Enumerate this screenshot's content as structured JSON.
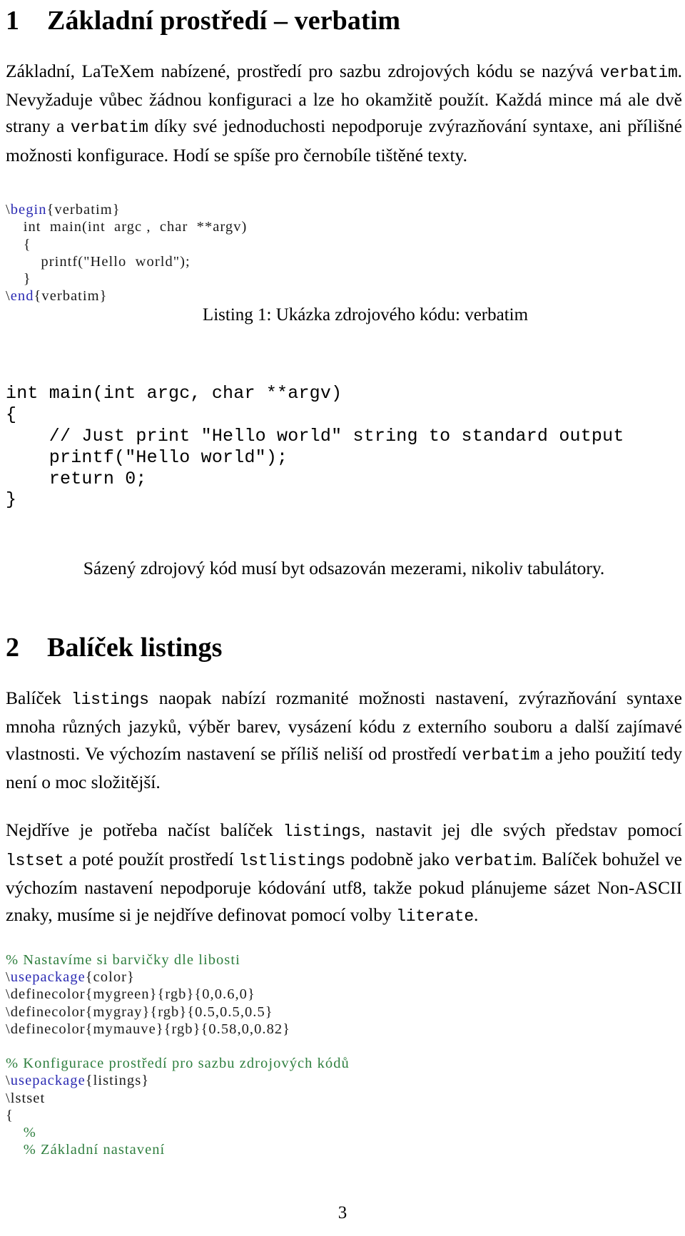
{
  "document": {
    "page_number": "3",
    "colors": {
      "keyword_blue": "#2b2bb3",
      "comment_green": "#2f7f3f",
      "body_text": "#000000",
      "background": "#ffffff"
    }
  },
  "section1": {
    "number": "1",
    "title": "Základní prostředí – verbatim",
    "paragraph": "Základní, LaTeXem nabízené, prostředí pro sazbu zdrojových kódu se nazývá verbatim. Nevyžaduje vůbec žádnou konfiguraci a lze ho okamžitě použít. Každá mince má ale dvě strany a verbatim díky své jednoduchosti nepodporuje zvýrazňování syntaxe, ani přílišné možnosti konfigurace. Hodí se spíše pro černobíle tištěné texty.",
    "paragraph_parts": {
      "p1": "Základní, LaTeXem nabízené, prostředí pro sazbu zdrojových kódu se nazývá ",
      "tt1": "verbatim",
      "p2": ". Nevyžaduje vůbec žádnou konfiguraci a lze ho okamžitě použít. Každá mince má ale dvě strany a ",
      "tt2": "verbatim",
      "p3": " díky své jednoduchosti nepodporuje zvýrazňování syntaxe, ani přílišné možnosti konfigurace. Hodí se spíše pro černobíle tištěné texty."
    }
  },
  "tex_listing_1": {
    "lines": [
      {
        "segments": [
          {
            "text": "\\",
            "style": "plain"
          },
          {
            "text": "begin",
            "style": "kw"
          },
          {
            "text": "{verbatim}",
            "style": "plain"
          }
        ]
      },
      {
        "segments": [
          {
            "text": "    int  main(int  argc ,  char  **argv)",
            "style": "plain"
          }
        ]
      },
      {
        "segments": [
          {
            "text": "    {",
            "style": "plain"
          }
        ]
      },
      {
        "segments": [
          {
            "text": "        printf(\"Hello  world\");",
            "style": "plain"
          }
        ]
      },
      {
        "segments": [
          {
            "text": "    }",
            "style": "plain"
          }
        ]
      },
      {
        "segments": [
          {
            "text": "\\",
            "style": "plain"
          },
          {
            "text": "end",
            "style": "kw"
          },
          {
            "text": "{verbatim}",
            "style": "plain"
          }
        ]
      }
    ]
  },
  "listing_caption_1": {
    "label": "Listing 1:",
    "text": "Ukázka zdrojového kódu: verbatim",
    "full": "Listing 1: Ukázka zdrojového kódu: verbatim"
  },
  "verbatim_output": {
    "lines": [
      "int main(int argc, char **argv)",
      "{",
      "    // Just print \"Hello world\" string to standard output",
      "    printf(\"Hello world\");",
      "    return 0;",
      "}"
    ]
  },
  "note_after_code": "Sázený zdrojový kód musí byt odsazován mezerami, nikoliv tabulátory.",
  "section2": {
    "number": "2",
    "title": "Balíček listings",
    "paragraph1_parts": {
      "p1": "Balíček ",
      "tt1": "listings",
      "p2": " naopak nabízí rozmanité možnosti nastavení, zvýrazňování syntaxe mnoha různých jazyků, výběr barev, vysázení kódu z externího souboru a další zajímavé vlastnosti. Ve výchozím nastavení se příliš neliší od prostředí ",
      "tt2": "verbatim",
      "p3": " a jeho použití tedy není o moc složitější."
    },
    "paragraph2_parts": {
      "p1": "Nejdříve je potřeba načíst balíček ",
      "tt1": "listings",
      "p2": ", nastavit jej dle svých představ pomocí ",
      "tt2": "lstset",
      "p3": " a poté použít prostředí ",
      "tt3": "lstlistings",
      "p4": " podobně jako ",
      "tt4": "verbatim",
      "p5": ". Balíček bohužel ve výchozím nastavení nepodporuje kódování utf8, takže pokud plánujeme sázet Non-ASCII znaky, musíme si je nejdříve definovat pomocí volby ",
      "tt5": "literate",
      "p6": "."
    }
  },
  "tex_listing_2": {
    "lines": [
      {
        "segments": [
          {
            "text": "% Nastavíme si barvičky dle libosti",
            "style": "cmt"
          }
        ]
      },
      {
        "segments": [
          {
            "text": "\\",
            "style": "plain"
          },
          {
            "text": "usepackage",
            "style": "kw"
          },
          {
            "text": "{color}",
            "style": "plain"
          }
        ]
      },
      {
        "segments": [
          {
            "text": "\\definecolor{mygreen}{rgb}{0,0.6,0}",
            "style": "plain"
          }
        ]
      },
      {
        "segments": [
          {
            "text": "\\definecolor{mygray}{rgb}{0.5,0.5,0.5}",
            "style": "plain"
          }
        ]
      },
      {
        "segments": [
          {
            "text": "\\definecolor{mymauve}{rgb}{0.58,0,0.82}",
            "style": "plain"
          }
        ]
      },
      {
        "segments": [
          {
            "text": " ",
            "style": "plain"
          }
        ]
      },
      {
        "segments": [
          {
            "text": "% Konfigurace prostředí pro sazbu zdrojových kódů",
            "style": "cmt"
          }
        ]
      },
      {
        "segments": [
          {
            "text": "\\",
            "style": "plain"
          },
          {
            "text": "usepackage",
            "style": "kw"
          },
          {
            "text": "{listings}",
            "style": "plain"
          }
        ]
      },
      {
        "segments": [
          {
            "text": "\\lstset",
            "style": "plain"
          }
        ]
      },
      {
        "segments": [
          {
            "text": "{",
            "style": "plain"
          }
        ]
      },
      {
        "segments": [
          {
            "text": "    %",
            "style": "cmt"
          }
        ]
      },
      {
        "segments": [
          {
            "text": "    % Základní nastavení",
            "style": "cmt"
          }
        ]
      }
    ]
  }
}
